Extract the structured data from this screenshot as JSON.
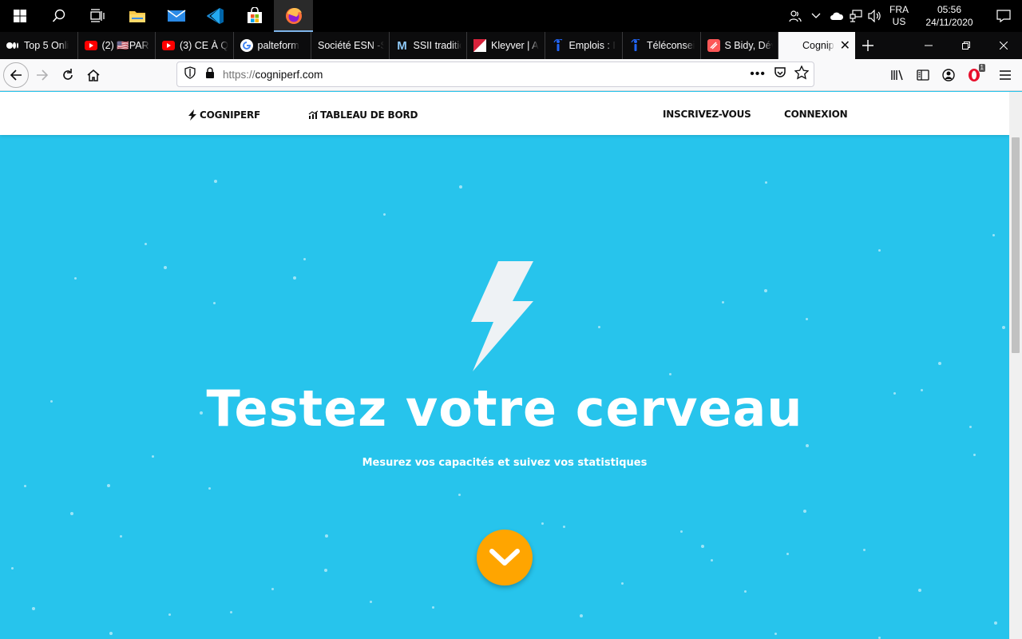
{
  "taskbar": {
    "apps": [
      "start-icon",
      "search-icon",
      "task-view-icon",
      "file-explorer-icon",
      "mail-icon",
      "vscode-icon",
      "store-icon",
      "firefox-icon"
    ],
    "lang_primary": "FRA",
    "lang_secondary": "US",
    "time": "05:56",
    "date": "24/11/2020"
  },
  "browser": {
    "tabs": [
      {
        "label": "Top 5 Onli",
        "icon": "medium-icon"
      },
      {
        "label": "(2) 🇺🇸PARI",
        "icon": "youtube-icon"
      },
      {
        "label": "(3) CE À Q",
        "icon": "youtube-icon"
      },
      {
        "label": "palteform",
        "icon": "google-icon"
      },
      {
        "label": "Société ESN -S",
        "icon": "blank-icon"
      },
      {
        "label": "SSII traditio",
        "icon": "m-logo-icon"
      },
      {
        "label": "Kleyver | A",
        "icon": "kleyver-icon"
      },
      {
        "label": "Emplois : I",
        "icon": "indeed-icon"
      },
      {
        "label": "Téléconsei",
        "icon": "indeed-icon"
      },
      {
        "label": "S Bidy, Dév",
        "icon": "malt-icon"
      },
      {
        "label": "Cognip",
        "icon": "blank-icon",
        "selected": true
      }
    ],
    "url_scheme": "https://",
    "url_host": "cogniperf.com",
    "notification_count": "1"
  },
  "site": {
    "brand": "COGNIPERF",
    "dashboard": "TABLEAU DE BORD",
    "signup": "INSCRIVEZ-VOUS",
    "login": "CONNEXION",
    "hero_title": "Testez votre cerveau",
    "hero_subtitle": "Mesurez vos capacités et suivez vos statistiques"
  },
  "colors": {
    "hero_bg": "#27c4ec",
    "cta": "#ffa500"
  }
}
